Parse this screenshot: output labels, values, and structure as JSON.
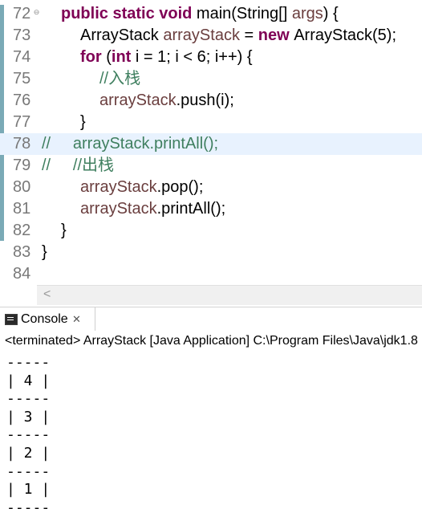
{
  "editor": {
    "lines": [
      {
        "num": "72",
        "folded": true,
        "indent": 1,
        "segments": [
          {
            "t": "public static void ",
            "c": "kw"
          },
          {
            "t": "main(String[] ",
            "c": "tok"
          },
          {
            "t": "args",
            "c": "var"
          },
          {
            "t": ") {",
            "c": "tok"
          }
        ]
      },
      {
        "num": "73",
        "indent": 2,
        "segments": [
          {
            "t": "ArrayStack ",
            "c": "tok"
          },
          {
            "t": "arrayStack",
            "c": "var"
          },
          {
            "t": " = ",
            "c": "tok"
          },
          {
            "t": "new ",
            "c": "kw"
          },
          {
            "t": "ArrayStack(5);",
            "c": "tok"
          }
        ]
      },
      {
        "num": "74",
        "indent": 2,
        "segments": [
          {
            "t": "for",
            "c": "kw"
          },
          {
            "t": " (",
            "c": "tok"
          },
          {
            "t": "int",
            "c": "kw"
          },
          {
            "t": " i = 1; i < 6; i++) {",
            "c": "tok"
          }
        ]
      },
      {
        "num": "75",
        "indent": 3,
        "segments": [
          {
            "t": "//入栈",
            "c": "cmt"
          }
        ]
      },
      {
        "num": "76",
        "indent": 3,
        "segments": [
          {
            "t": "arrayStack",
            "c": "var"
          },
          {
            "t": ".push(i);",
            "c": "tok"
          }
        ]
      },
      {
        "num": "77",
        "indent": 2,
        "segments": [
          {
            "t": "}",
            "c": "tok"
          }
        ]
      },
      {
        "num": "78",
        "indent": 0,
        "highlight": true,
        "segments": [
          {
            "t": "//     arrayStack.printAll();",
            "c": "cmt"
          }
        ]
      },
      {
        "num": "79",
        "indent": 0,
        "segments": [
          {
            "t": "//     //出栈",
            "c": "cmt"
          }
        ]
      },
      {
        "num": "80",
        "indent": 2,
        "segments": [
          {
            "t": "arrayStack",
            "c": "var"
          },
          {
            "t": ".pop();",
            "c": "tok"
          }
        ]
      },
      {
        "num": "81",
        "indent": 2,
        "segments": [
          {
            "t": "arrayStack",
            "c": "var"
          },
          {
            "t": ".printAll();",
            "c": "tok"
          }
        ]
      },
      {
        "num": "82",
        "indent": 1,
        "segments": [
          {
            "t": "}",
            "c": "tok"
          }
        ]
      },
      {
        "num": "83",
        "indent": 0,
        "segments": [
          {
            "t": "}",
            "c": "tok"
          }
        ]
      },
      {
        "num": "84",
        "indent": 0,
        "segments": []
      }
    ],
    "scroll_left_glyph": "<",
    "fold_glyph": "⊖"
  },
  "console": {
    "tab_label": "Console",
    "close_glyph": "✕",
    "icon": "console-icon",
    "status": "<terminated> ArrayStack [Java Application] C:\\Program Files\\Java\\jdk1.8",
    "output": [
      "-----",
      "| 4 |",
      "-----",
      "| 3 |",
      "-----",
      "| 2 |",
      "-----",
      "| 1 |",
      "-----"
    ]
  }
}
